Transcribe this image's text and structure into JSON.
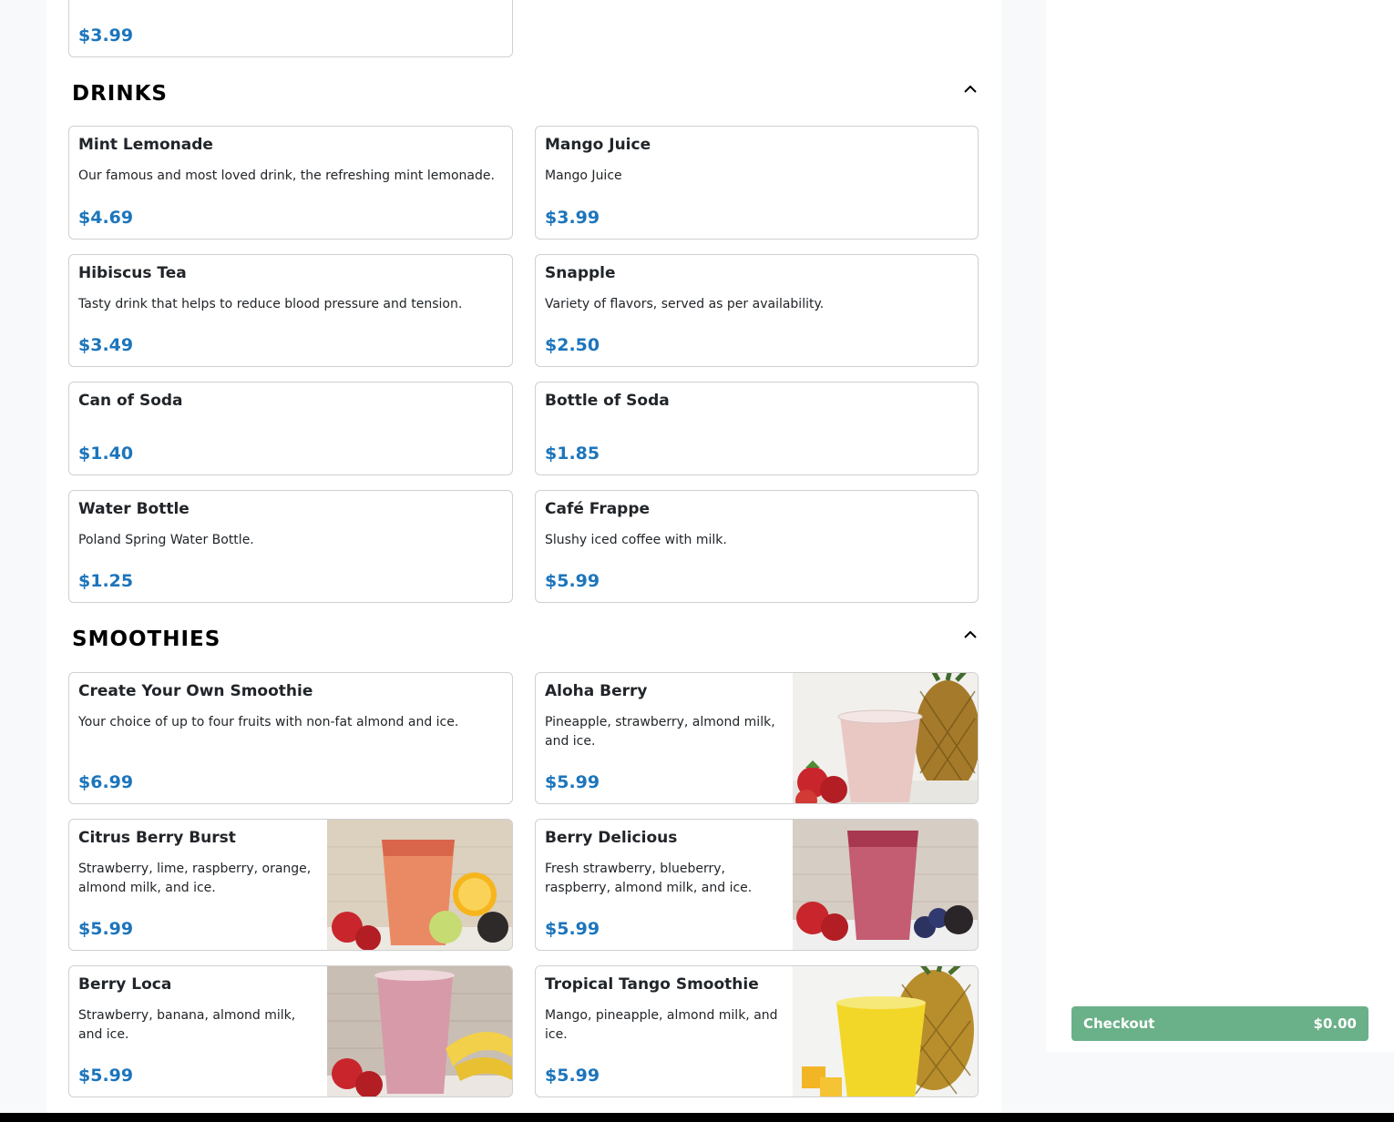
{
  "top_card": {
    "price": "$3.99"
  },
  "drinks": {
    "title": "DRINKS",
    "items": [
      {
        "name": "Mint Lemonade",
        "desc": "Our famous and most loved drink, the refreshing mint lemonade.",
        "price": "$4.69"
      },
      {
        "name": "Mango Juice",
        "desc": "Mango Juice",
        "price": "$3.99"
      },
      {
        "name": "Hibiscus Tea",
        "desc": "Tasty drink that helps to reduce blood pressure and tension.",
        "price": "$3.49"
      },
      {
        "name": "Snapple",
        "desc": "Variety of flavors, served as per availability.",
        "price": "$2.50"
      },
      {
        "name": "Can of Soda",
        "desc": "",
        "price": "$1.40"
      },
      {
        "name": "Bottle of Soda",
        "desc": "",
        "price": "$1.85"
      },
      {
        "name": "Water Bottle",
        "desc": "Poland Spring Water Bottle.",
        "price": "$1.25"
      },
      {
        "name": "Café Frappe",
        "desc": "Slushy iced coffee with milk.",
        "price": "$5.99"
      }
    ]
  },
  "smoothies": {
    "title": "SMOOTHIES",
    "items": [
      {
        "name": "Create Your Own Smoothie",
        "desc": "Your choice of up to four fruits with non-fat almond and ice.",
        "price": "$6.99"
      },
      {
        "name": "Aloha Berry",
        "desc": "Pineapple, strawberry, almond milk, and ice.",
        "price": "$5.99"
      },
      {
        "name": "Citrus Berry Burst",
        "desc": "Strawberry, lime, raspberry, orange, almond milk, and ice.",
        "price": "$5.99"
      },
      {
        "name": "Berry Delicious",
        "desc": "Fresh strawberry, blueberry, raspberry, almond milk, and ice.",
        "price": "$5.99"
      },
      {
        "name": "Berry Loca",
        "desc": "Strawberry, banana, almond milk, and ice.",
        "price": "$5.99"
      },
      {
        "name": "Tropical Tango Smoothie",
        "desc": "Mango, pineapple, almond milk, and ice.",
        "price": "$5.99"
      }
    ]
  },
  "cart": {
    "checkout_label": "Checkout",
    "total": "$0.00"
  },
  "colors": {
    "price": "#1c75bc",
    "checkout_bg": "#6ab088"
  }
}
